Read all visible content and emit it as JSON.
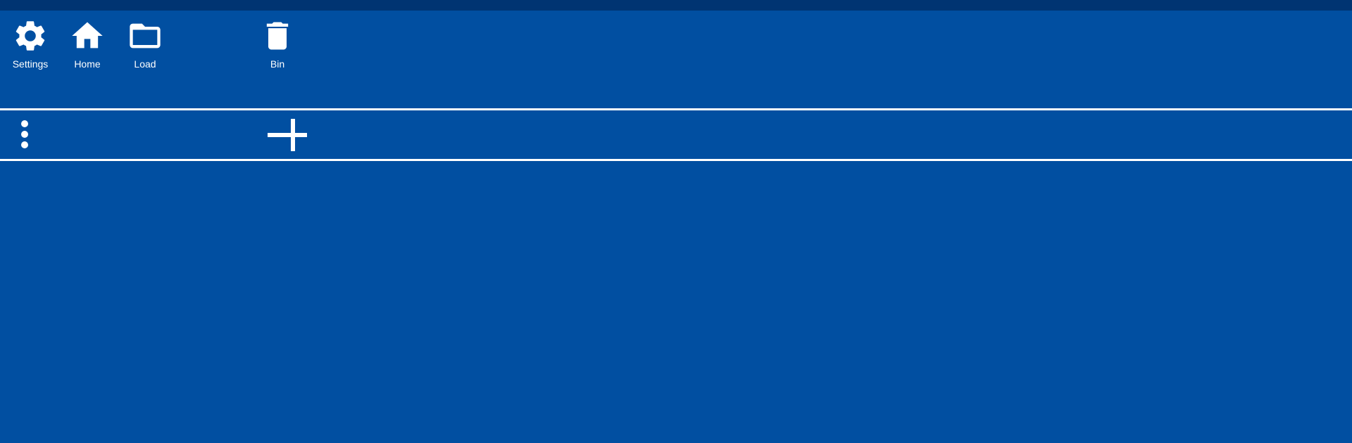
{
  "toolbar": {
    "settings_label": "Settings",
    "home_label": "Home",
    "load_label": "Load",
    "bin_label": "Bin"
  },
  "colors": {
    "background": "#014fa1",
    "status_strip": "#003472",
    "foreground": "#ffffff"
  },
  "icons": {
    "settings": "gear-icon",
    "home": "home-icon",
    "load": "folder-icon",
    "bin": "trash-icon",
    "more": "more-vertical-icon",
    "add": "plus-icon"
  }
}
